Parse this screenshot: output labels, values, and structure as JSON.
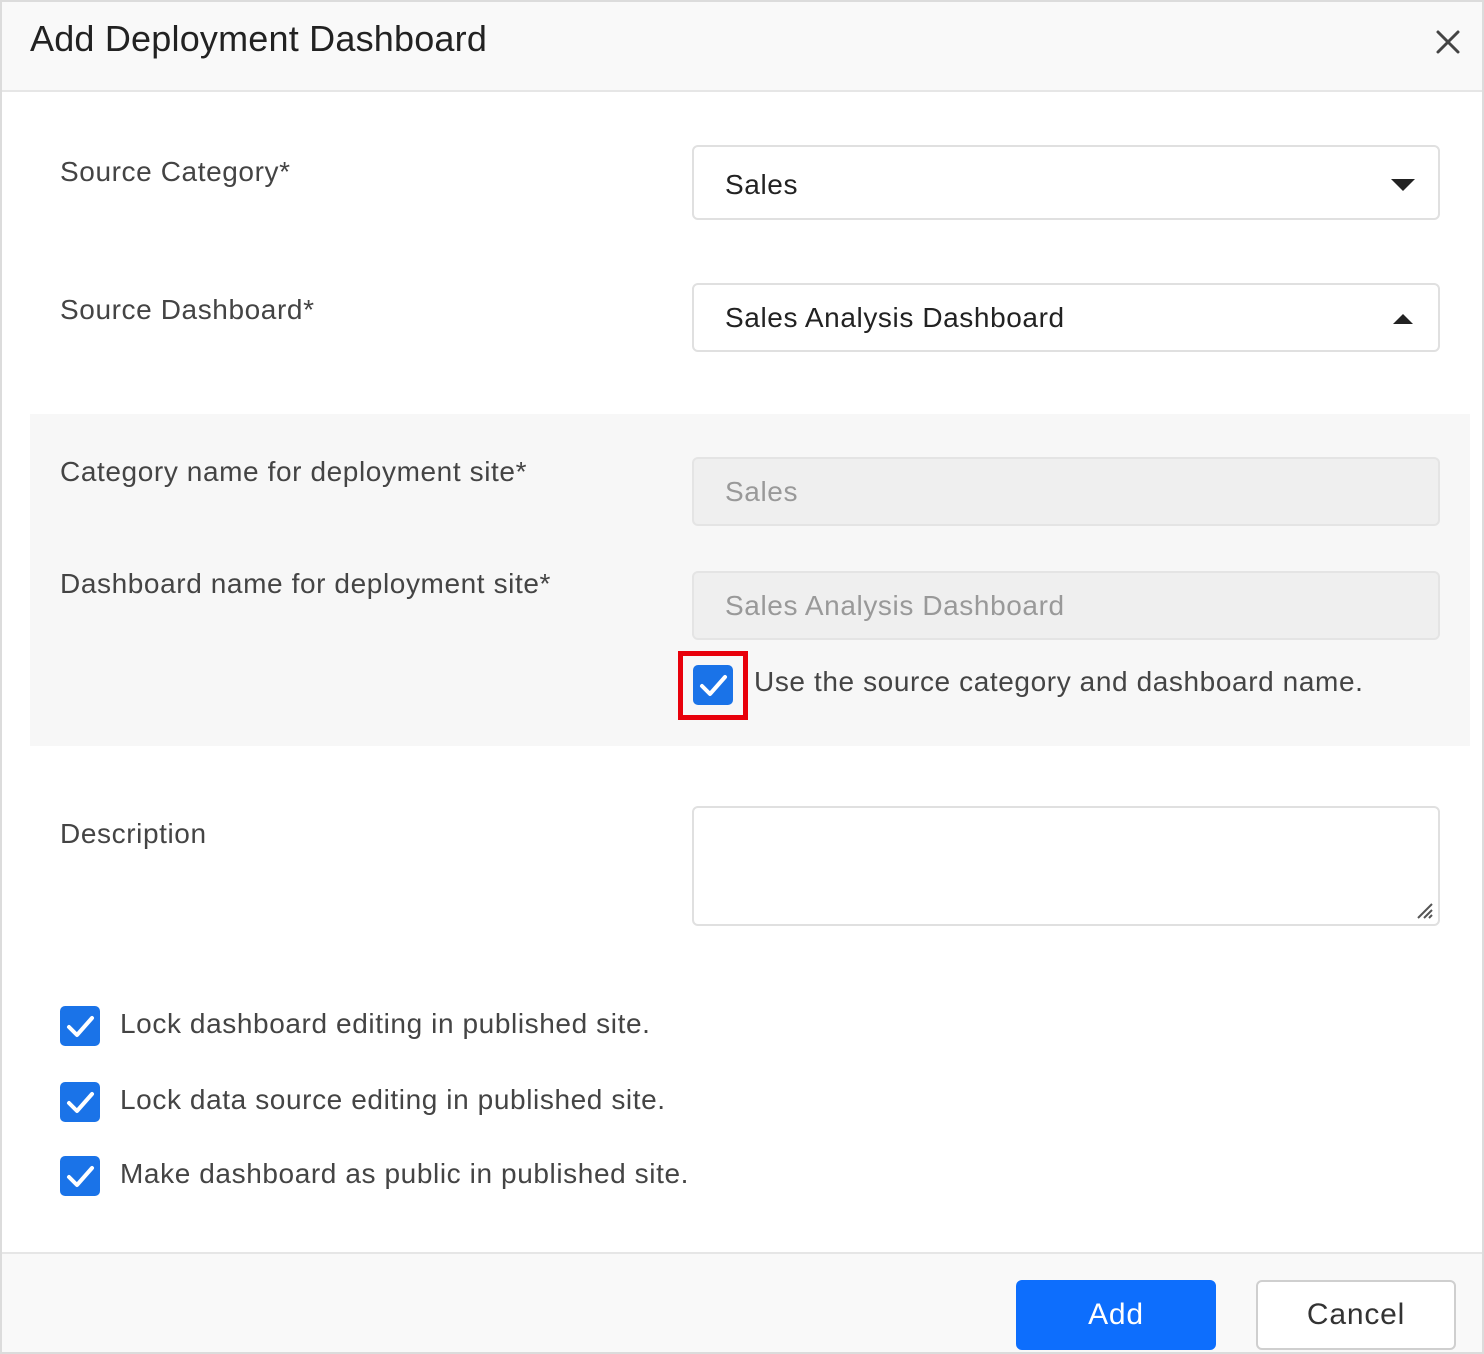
{
  "dialog": {
    "title": "Add Deployment Dashboard",
    "close_icon": "close-icon"
  },
  "form": {
    "source_category": {
      "label": "Source Category*",
      "value": "Sales",
      "state": "collapsed"
    },
    "source_dashboard": {
      "label": "Source Dashboard*",
      "value": "Sales Analysis Dashboard",
      "state": "expanded"
    },
    "deploy_category": {
      "label": "Category name for deployment site*",
      "value": "Sales"
    },
    "deploy_dashboard": {
      "label": "Dashboard name for deployment site*",
      "value": "Sales Analysis Dashboard"
    },
    "use_source_names": {
      "label": "Use the source category and dashboard name.",
      "checked": true
    },
    "description": {
      "label": "Description",
      "value": ""
    },
    "options": [
      {
        "label": "Lock dashboard editing in published site.",
        "checked": true
      },
      {
        "label": "Lock data source editing in published site.",
        "checked": true
      },
      {
        "label": "Make dashboard as public in published site.",
        "checked": true
      }
    ]
  },
  "footer": {
    "add_label": "Add",
    "cancel_label": "Cancel"
  },
  "colors": {
    "accent": "#0d6efd",
    "checkbox": "#1a73e8",
    "highlight": "#e8000b"
  }
}
